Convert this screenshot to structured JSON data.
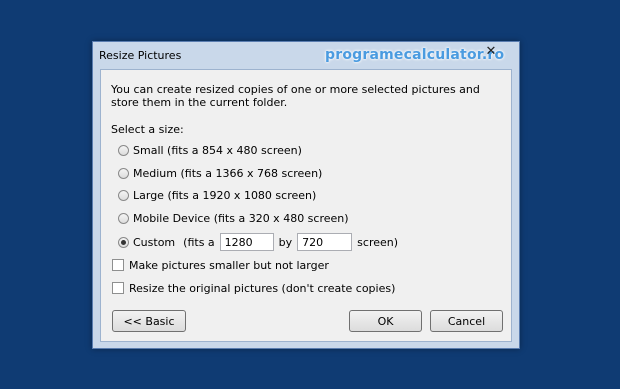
{
  "dialog": {
    "title": "Resize Pictures",
    "watermark": "programecalculator.ro",
    "close_icon": "close-icon",
    "description": "You can create resized copies of one or more selected pictures and store them in the current folder.",
    "select_label": "Select a size:",
    "sizes": [
      {
        "label": "Small (fits a 854 x 480 screen)",
        "checked": false
      },
      {
        "label": "Medium (fits a 1366 x 768 screen)",
        "checked": false
      },
      {
        "label": "Large (fits a 1920 x 1080 screen)",
        "checked": false
      },
      {
        "label": "Mobile Device (fits a 320 x 480 screen)",
        "checked": false
      }
    ],
    "custom": {
      "label": "Custom",
      "fits_prefix": "(fits a",
      "width": "1280",
      "by": "by",
      "height": "720",
      "suffix": "screen)",
      "checked": true
    },
    "options": [
      {
        "label": "Make pictures smaller but not larger",
        "checked": false
      },
      {
        "label": "Resize the original pictures (don't create copies)",
        "checked": false
      }
    ],
    "buttons": {
      "basic": "<< Basic",
      "ok": "OK",
      "cancel": "Cancel"
    }
  }
}
